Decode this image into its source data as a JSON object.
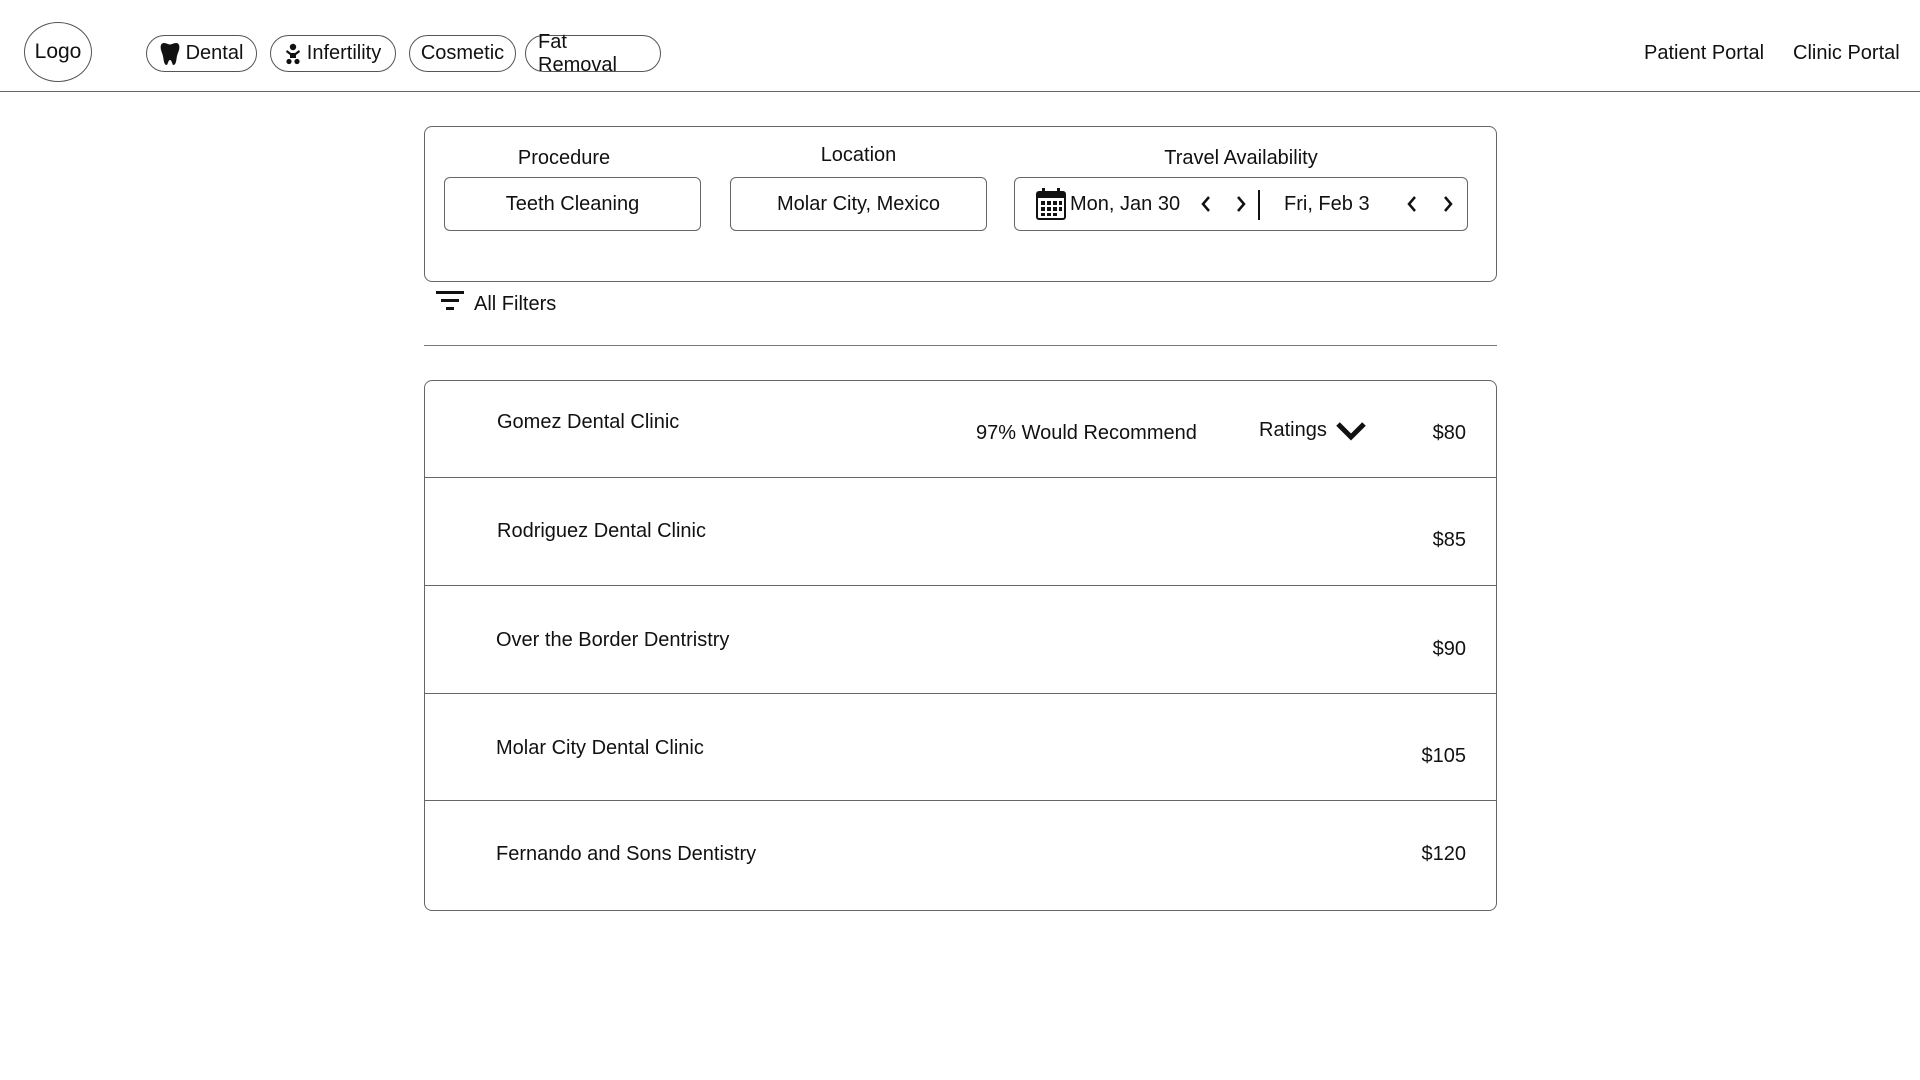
{
  "header": {
    "logo": "Logo",
    "categories": [
      {
        "label": "Dental",
        "icon": "tooth-icon"
      },
      {
        "label": "Infertility",
        "icon": "baby-icon"
      },
      {
        "label": "Cosmetic",
        "icon": ""
      },
      {
        "label": "Fat Removal",
        "icon": ""
      }
    ],
    "patient_portal": "Patient Portal",
    "clinic_portal": "Clinic Portal"
  },
  "search": {
    "procedure_label": "Procedure",
    "procedure_value": "Teeth Cleaning",
    "location_label": "Location",
    "location_value": "Molar City, Mexico",
    "travel_label": "Travel Availability",
    "start_date": "Mon, Jan 30",
    "end_date": "Fri, Feb 3",
    "calendar_icon": "calendar-icon"
  },
  "filters": {
    "label": "All Filters",
    "icon": "filter-icon"
  },
  "results": {
    "featured": {
      "recommend": "97% Would Recommend",
      "ratings_label": "Ratings"
    },
    "clinics": [
      {
        "name": "Gomez Dental Clinic",
        "price": "$80"
      },
      {
        "name": "Rodriguez Dental Clinic",
        "price": "$85"
      },
      {
        "name": "Over the Border Dentristry",
        "price": "$90"
      },
      {
        "name": "Molar City Dental Clinic",
        "price": "$105"
      },
      {
        "name": "Fernando and Sons Dentistry",
        "price": "$120"
      }
    ]
  }
}
